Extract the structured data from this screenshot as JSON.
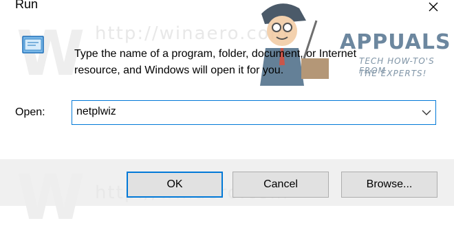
{
  "window": {
    "title": "Run",
    "close_icon": "close-icon"
  },
  "dialog": {
    "icon": "run-icon",
    "description_line1": "Type the name of a program, folder, document, or Internet",
    "description_line2": "resource, and Windows will open it for you.",
    "open_label": "Open:",
    "open_value": "netplwiz"
  },
  "buttons": {
    "ok": "OK",
    "cancel": "Cancel",
    "browse": "Browse..."
  },
  "watermark": {
    "url_top": "http://winaero.com",
    "url_bottom": "http://winaero.com",
    "brand": "APPUALS",
    "tagline_line1": "TECH HOW-TO'S FROM",
    "tagline_line2": "THE EXPERTS!"
  },
  "colors": {
    "accent": "#0078d7",
    "footer_bg": "#f0f0f0",
    "button_bg": "#e1e1e1"
  }
}
